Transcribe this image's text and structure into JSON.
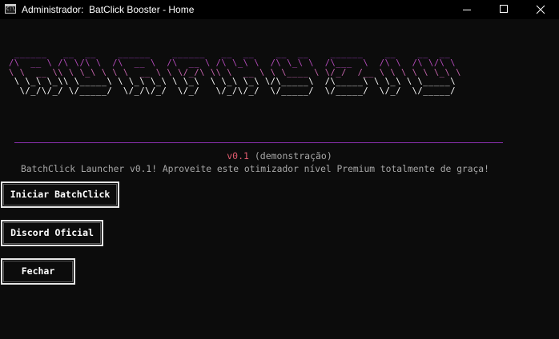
{
  "window": {
    "title": "Administrador:  BatClick Booster - Home",
    "icon_text": "C:\\",
    "controls": [
      "minimize-icon",
      "maximize-icon",
      "close-icon"
    ]
  },
  "banner": {
    "ascii_lines": [
      " ______   __  __    ______    ______   __  __    __  __    ______    __    __  __ ",
      "/\\  __ \\ /\\ \\/\\ \\  /\\  __ \\  /\\  __ \\ /\\ \\_\\ \\  /\\ \\_\\ \\  /\\___  \\  /\\ \\  /\\ \\/\\ \\ ",
      "\\ \\  __ \\\\ \\ \\_\\ \\ \\ \\  __ \\ \\ \\/_/\\ \\\\ \\  __ \\ \\ \\____ \\ \\/_/  /__ \\ \\ \\ \\ \\ \\_\\ \\",
      " \\ \\_\\ \\_\\\\ \\_____\\ \\ \\_\\ \\_\\ \\ \\_\\  \\ \\_\\ \\_\\ \\/\\_____\\  /\\_____\\ \\ \\_\\ \\ \\_____\\",
      "  \\/_/\\/_/ \\/_____/  \\/_/\\/_/  \\/_/   \\/_/\\/_/  \\/_____/  \\/_____/  \\/_/  \\/_____/"
    ],
    "gradient_colors": [
      "#a13ec2",
      "#b64bbd",
      "#c866b0",
      "#ffffff",
      "#ffffff"
    ]
  },
  "divider_color": "#8b2fb0",
  "version": {
    "number": "v0.1",
    "note": " (demonstração)"
  },
  "subtitle": "BatchClick Launcher v0.1! Aproveite este otimizador nível Premium totalmente de graça!",
  "menu": {
    "start_label": "Iniciar BatchClick",
    "discord_label": "Discord Oficial",
    "close_label": "Fechar"
  },
  "colors": {
    "background": "#0c0c0c",
    "accent_purple": "#a13ec2",
    "version_red": "#e05a6e",
    "text_gray": "#a8a8a8"
  }
}
